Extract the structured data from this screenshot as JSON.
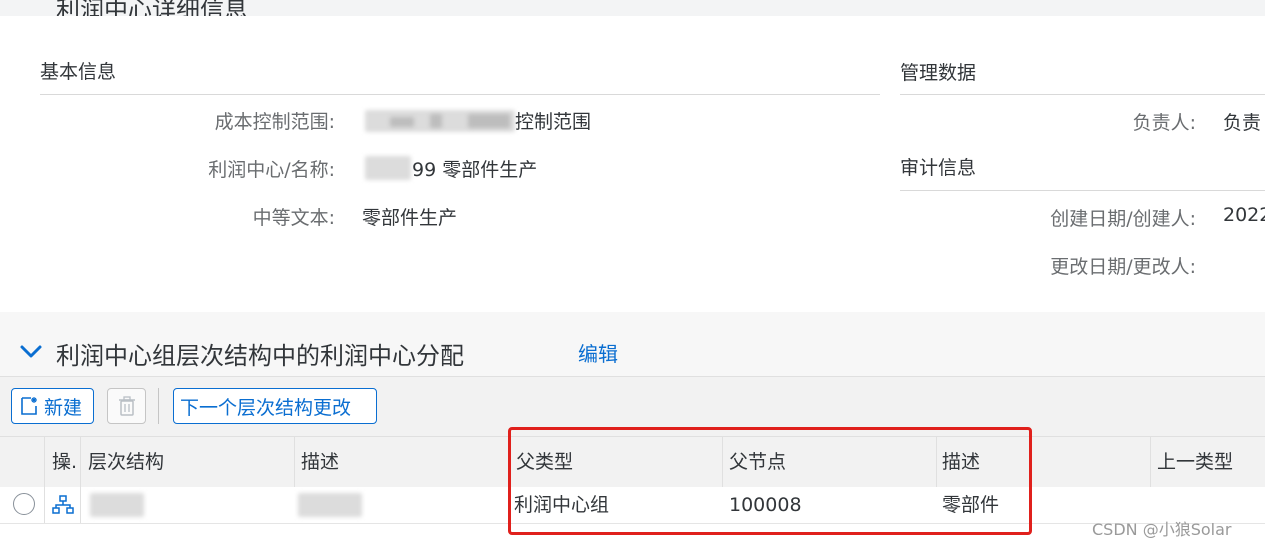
{
  "header": {
    "title": "利润中心详细信息"
  },
  "basic_info": {
    "title": "基本信息",
    "fields": [
      {
        "label": "成本控制范围:",
        "value": "控制范围"
      },
      {
        "label": "利润中心/名称:",
        "value": "99 零部件生产"
      },
      {
        "label": "中等文本:",
        "value": "零部件生产"
      }
    ]
  },
  "mgmt": {
    "title": "管理数据",
    "owner_label": "负责人:",
    "owner_value": "负责"
  },
  "audit": {
    "title": "审计信息",
    "created_label": "创建日期/创建人:",
    "created_value": "2022",
    "changed_label": "更改日期/更改人:"
  },
  "assignment": {
    "title": "利润中心组层次结构中的利润中心分配",
    "edit_label": "编辑",
    "toolbar": {
      "new_label": "新建",
      "next_change_label": "下一个层次结构更改"
    },
    "columns": [
      "操.",
      "层次结构",
      "描述",
      "父类型",
      "父节点",
      "描述",
      "上一类型"
    ],
    "rows": [
      {
        "parent_type": "利润中心组",
        "parent_node": "100008",
        "description": "零部件"
      }
    ]
  },
  "watermark": "CSDN @小狼Solar",
  "colors": {
    "link": "#0a6ed1",
    "highlight": "#e0201c"
  }
}
